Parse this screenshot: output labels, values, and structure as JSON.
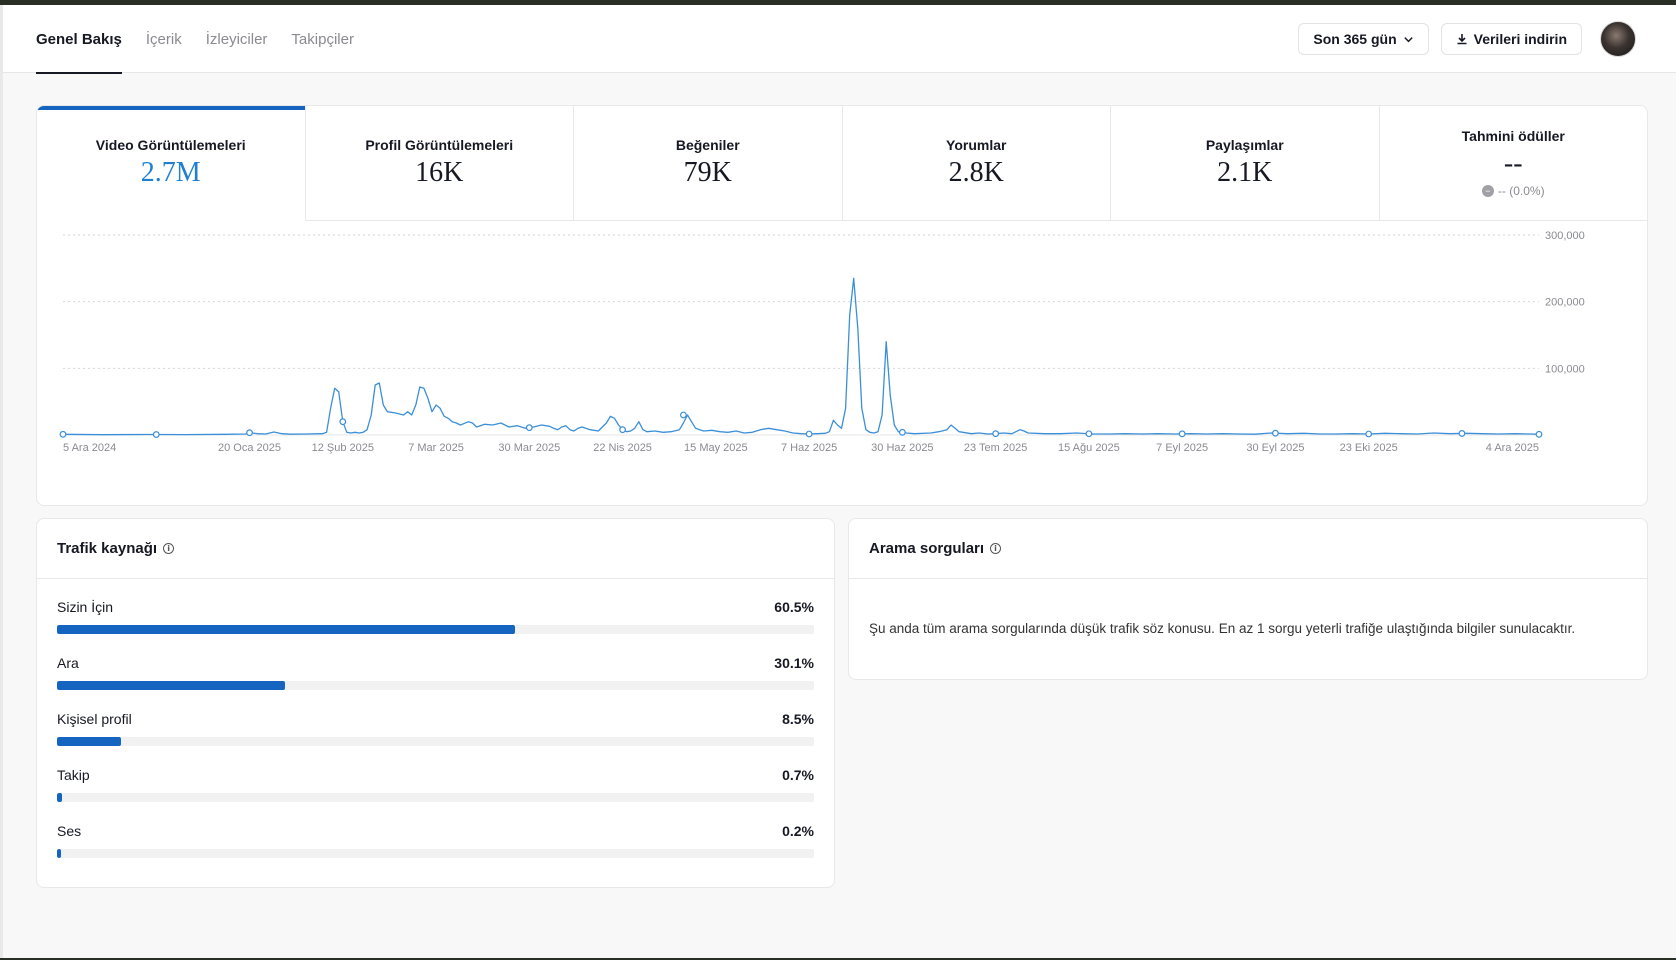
{
  "header": {
    "tabs": [
      {
        "label": "Genel Bakış",
        "active": true
      },
      {
        "label": "İçerik",
        "active": false
      },
      {
        "label": "İzleyiciler",
        "active": false
      },
      {
        "label": "Takipçiler",
        "active": false
      }
    ],
    "date_range_label": "Son 365 gün",
    "download_label": "Verileri indirin"
  },
  "metrics": [
    {
      "label": "Video Görüntülemeleri",
      "value": "2.7M",
      "active": true
    },
    {
      "label": "Profil Görüntülemeleri",
      "value": "16K"
    },
    {
      "label": "Beğeniler",
      "value": "79K"
    },
    {
      "label": "Yorumlar",
      "value": "2.8K"
    },
    {
      "label": "Paylaşımlar",
      "value": "2.1K"
    },
    {
      "label": "Tahmini ödüller",
      "value": "--",
      "sub": "-- (0.0%)"
    }
  ],
  "chart_data": {
    "type": "line",
    "series_color": "#3b8fd9",
    "ylim": [
      0,
      300000
    ],
    "yticks": [
      100000,
      200000,
      300000
    ],
    "ytick_labels": [
      "100,000",
      "200,000",
      "300,000"
    ],
    "grid": true,
    "start_date": "2024-12-05",
    "xtick_labels": [
      {
        "day": 0,
        "label": "5 Ara 2024"
      },
      {
        "day": 46,
        "label": "20 Oca 2025"
      },
      {
        "day": 69,
        "label": "12 Şub 2025"
      },
      {
        "day": 92,
        "label": "7 Mar 2025"
      },
      {
        "day": 115,
        "label": "30 Mar 2025"
      },
      {
        "day": 138,
        "label": "22 Nis 2025"
      },
      {
        "day": 161,
        "label": "15 May 2025"
      },
      {
        "day": 184,
        "label": "7 Haz 2025"
      },
      {
        "day": 207,
        "label": "30 Haz 2025"
      },
      {
        "day": 230,
        "label": "23 Tem 2025"
      },
      {
        "day": 253,
        "label": "15 Ağu 2025"
      },
      {
        "day": 276,
        "label": "7 Eyl 2025"
      },
      {
        "day": 299,
        "label": "30 Eyl 2025"
      },
      {
        "day": 322,
        "label": "23 Eki 2025"
      },
      {
        "day": 364,
        "label": "4 Ara 2025"
      }
    ],
    "points": [
      [
        0,
        1000
      ],
      [
        10,
        500
      ],
      [
        20,
        800
      ],
      [
        23,
        700
      ],
      [
        30,
        600
      ],
      [
        40,
        1000
      ],
      [
        45,
        1500
      ],
      [
        46,
        3500
      ],
      [
        48,
        2000
      ],
      [
        50,
        1500
      ],
      [
        52,
        4500
      ],
      [
        54,
        2000
      ],
      [
        56,
        1200
      ],
      [
        60,
        1500
      ],
      [
        64,
        2000
      ],
      [
        65,
        4000
      ],
      [
        66,
        40000
      ],
      [
        67,
        70000
      ],
      [
        68,
        65000
      ],
      [
        69,
        20000
      ],
      [
        70,
        4000
      ],
      [
        71,
        3000
      ],
      [
        72,
        4000
      ],
      [
        73,
        3000
      ],
      [
        74,
        4000
      ],
      [
        75,
        8000
      ],
      [
        76,
        30000
      ],
      [
        77,
        75000
      ],
      [
        78,
        78000
      ],
      [
        79,
        45000
      ],
      [
        80,
        35000
      ],
      [
        82,
        33000
      ],
      [
        84,
        30000
      ],
      [
        85,
        35000
      ],
      [
        86,
        30000
      ],
      [
        87,
        45000
      ],
      [
        88,
        72000
      ],
      [
        89,
        70000
      ],
      [
        90,
        55000
      ],
      [
        91,
        35000
      ],
      [
        92,
        45000
      ],
      [
        93,
        40000
      ],
      [
        94,
        28000
      ],
      [
        95,
        25000
      ],
      [
        96,
        20000
      ],
      [
        97,
        18000
      ],
      [
        98,
        15000
      ],
      [
        100,
        20000
      ],
      [
        101,
        18000
      ],
      [
        102,
        12000
      ],
      [
        104,
        16000
      ],
      [
        106,
        15000
      ],
      [
        108,
        18000
      ],
      [
        110,
        12000
      ],
      [
        112,
        14000
      ],
      [
        114,
        10000
      ],
      [
        116,
        12000
      ],
      [
        118,
        15000
      ],
      [
        120,
        13000
      ],
      [
        121,
        10000
      ],
      [
        122,
        8000
      ],
      [
        123,
        12000
      ],
      [
        124,
        14000
      ],
      [
        125,
        8000
      ],
      [
        126,
        6000
      ],
      [
        127,
        10000
      ],
      [
        128,
        12000
      ],
      [
        130,
        8000
      ],
      [
        132,
        6000
      ],
      [
        134,
        18000
      ],
      [
        135,
        28000
      ],
      [
        136,
        25000
      ],
      [
        137,
        15000
      ],
      [
        138,
        8000
      ],
      [
        139,
        5000
      ],
      [
        140,
        6000
      ],
      [
        141,
        10000
      ],
      [
        142,
        20000
      ],
      [
        143,
        8000
      ],
      [
        144,
        5000
      ],
      [
        146,
        6000
      ],
      [
        148,
        4000
      ],
      [
        150,
        5000
      ],
      [
        152,
        8000
      ],
      [
        153,
        18000
      ],
      [
        154,
        30000
      ],
      [
        155,
        20000
      ],
      [
        156,
        10000
      ],
      [
        157,
        8000
      ],
      [
        158,
        6000
      ],
      [
        160,
        7000
      ],
      [
        162,
        5000
      ],
      [
        164,
        4000
      ],
      [
        166,
        6000
      ],
      [
        168,
        3000
      ],
      [
        170,
        4000
      ],
      [
        172,
        8000
      ],
      [
        174,
        10000
      ],
      [
        176,
        8000
      ],
      [
        178,
        6000
      ],
      [
        180,
        3000
      ],
      [
        182,
        2000
      ],
      [
        184,
        1500
      ],
      [
        186,
        2000
      ],
      [
        188,
        2500
      ],
      [
        189,
        5000
      ],
      [
        190,
        22000
      ],
      [
        191,
        15000
      ],
      [
        192,
        10000
      ],
      [
        193,
        40000
      ],
      [
        194,
        180000
      ],
      [
        195,
        235000
      ],
      [
        196,
        160000
      ],
      [
        197,
        40000
      ],
      [
        198,
        8000
      ],
      [
        199,
        4000
      ],
      [
        200,
        3000
      ],
      [
        201,
        5000
      ],
      [
        202,
        30000
      ],
      [
        203,
        140000
      ],
      [
        204,
        60000
      ],
      [
        205,
        15000
      ],
      [
        206,
        5000
      ],
      [
        208,
        3000
      ],
      [
        210,
        2000
      ],
      [
        214,
        3000
      ],
      [
        216,
        5000
      ],
      [
        218,
        8000
      ],
      [
        219,
        15000
      ],
      [
        220,
        10000
      ],
      [
        221,
        5000
      ],
      [
        224,
        2000
      ],
      [
        226,
        3000
      ],
      [
        228,
        1500
      ],
      [
        230,
        2000
      ],
      [
        232,
        3000
      ],
      [
        234,
        2000
      ],
      [
        236,
        8000
      ],
      [
        237,
        6000
      ],
      [
        238,
        3000
      ],
      [
        242,
        2000
      ],
      [
        246,
        2000
      ],
      [
        250,
        3000
      ],
      [
        254,
        1500
      ],
      [
        258,
        1500
      ],
      [
        262,
        2000
      ],
      [
        266,
        1500
      ],
      [
        270,
        2000
      ],
      [
        274,
        1500
      ],
      [
        278,
        2000
      ],
      [
        282,
        1500
      ],
      [
        286,
        2000
      ],
      [
        290,
        1500
      ],
      [
        294,
        1200
      ],
      [
        298,
        3000
      ],
      [
        302,
        2000
      ],
      [
        306,
        2500
      ],
      [
        310,
        1500
      ],
      [
        314,
        1500
      ],
      [
        318,
        2000
      ],
      [
        322,
        1500
      ],
      [
        326,
        2500
      ],
      [
        330,
        2000
      ],
      [
        334,
        1500
      ],
      [
        338,
        3000
      ],
      [
        342,
        2000
      ],
      [
        346,
        2500
      ],
      [
        350,
        2000
      ],
      [
        354,
        1500
      ],
      [
        358,
        2000
      ],
      [
        362,
        1500
      ],
      [
        364,
        1000
      ]
    ],
    "markers": [
      0,
      23,
      46,
      69,
      115,
      138,
      184,
      207,
      230,
      253,
      276,
      299,
      322,
      345,
      364
    ]
  },
  "traffic": {
    "title": "Trafik kaynağı",
    "rows": [
      {
        "label": "Sizin İçin",
        "pct_label": "60.5%",
        "pct": 60.5
      },
      {
        "label": "Ara",
        "pct_label": "30.1%",
        "pct": 30.1
      },
      {
        "label": "Kişisel profil",
        "pct_label": "8.5%",
        "pct": 8.5
      },
      {
        "label": "Takip",
        "pct_label": "0.7%",
        "pct": 0.7
      },
      {
        "label": "Ses",
        "pct_label": "0.2%",
        "pct": 0.2
      }
    ]
  },
  "queries": {
    "title": "Arama sorguları",
    "message": "Şu anda tüm arama sorgularında düşük trafik söz konusu. En az 1 sorgu yeterli trafiğe ulaştığında bilgiler sunulacaktır."
  }
}
